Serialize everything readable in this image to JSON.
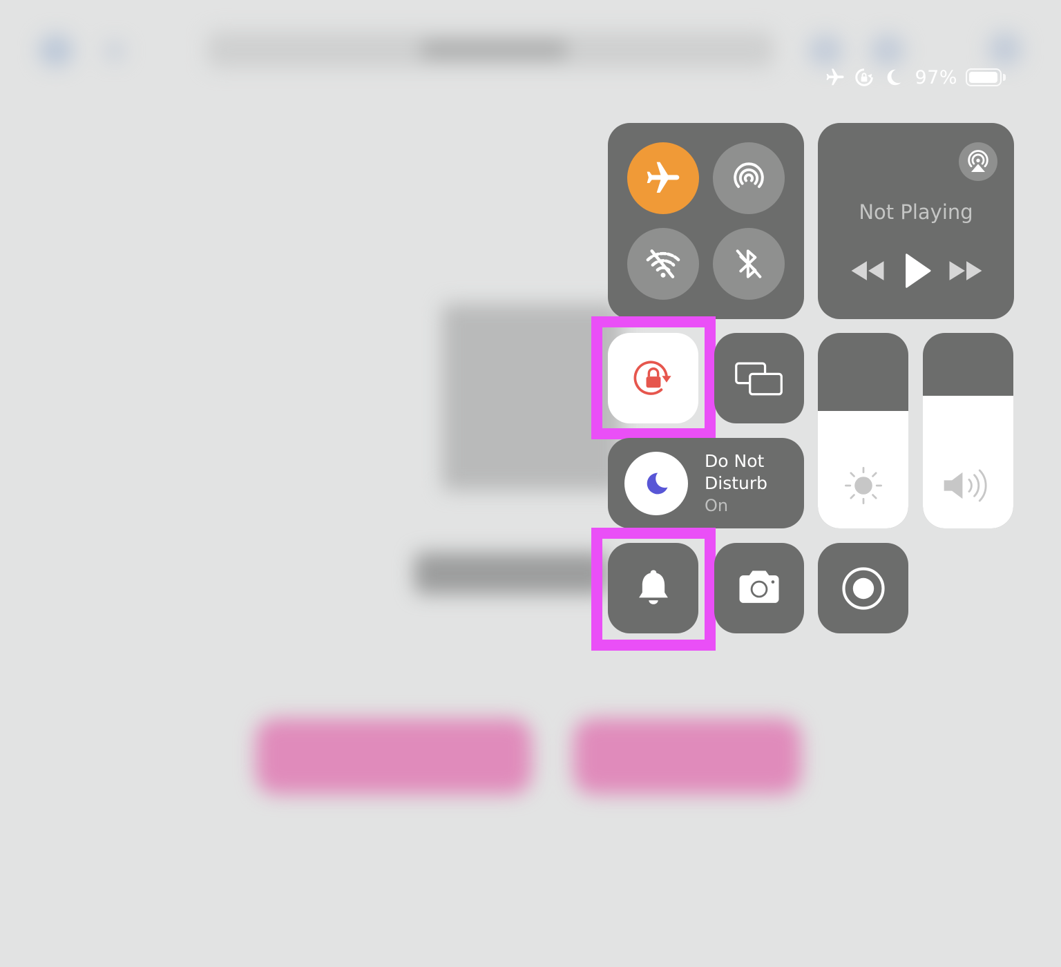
{
  "status_bar": {
    "icons": [
      "airplane-icon",
      "rotation-lock-icon",
      "moon-icon"
    ],
    "battery_percent": "97%",
    "battery_level": 0.97
  },
  "control_center": {
    "connectivity": [
      {
        "name": "airplane-mode",
        "icon": "airplane-icon",
        "state": "on",
        "color": "#f09a37"
      },
      {
        "name": "airdrop",
        "icon": "airdrop-icon",
        "state": "off"
      },
      {
        "name": "wifi",
        "icon": "wifi-off-icon",
        "state": "off"
      },
      {
        "name": "bluetooth",
        "icon": "bluetooth-off-icon",
        "state": "off"
      }
    ],
    "now_playing": {
      "title": "Not Playing",
      "controls": [
        "rewind-icon",
        "play-icon",
        "fast-forward-icon"
      ]
    },
    "orientation_lock": {
      "icon": "rotation-lock-icon",
      "state": "on",
      "color": "#e6564d"
    },
    "screen_mirroring": {
      "icon": "screen-mirroring-icon"
    },
    "brightness": {
      "icon": "sun-icon",
      "level": 0.6
    },
    "volume": {
      "icon": "speaker-icon",
      "level": 0.68
    },
    "do_not_disturb": {
      "title": "Do Not Disturb",
      "state_label": "On",
      "color": "#5856d6"
    },
    "silent_mode": {
      "icon": "bell-icon"
    },
    "camera": {
      "icon": "camera-icon"
    },
    "screen_recording": {
      "icon": "screen-record-icon"
    }
  },
  "colors": {
    "highlight": "#ea4ff7",
    "tile": "#6c6d6c"
  }
}
